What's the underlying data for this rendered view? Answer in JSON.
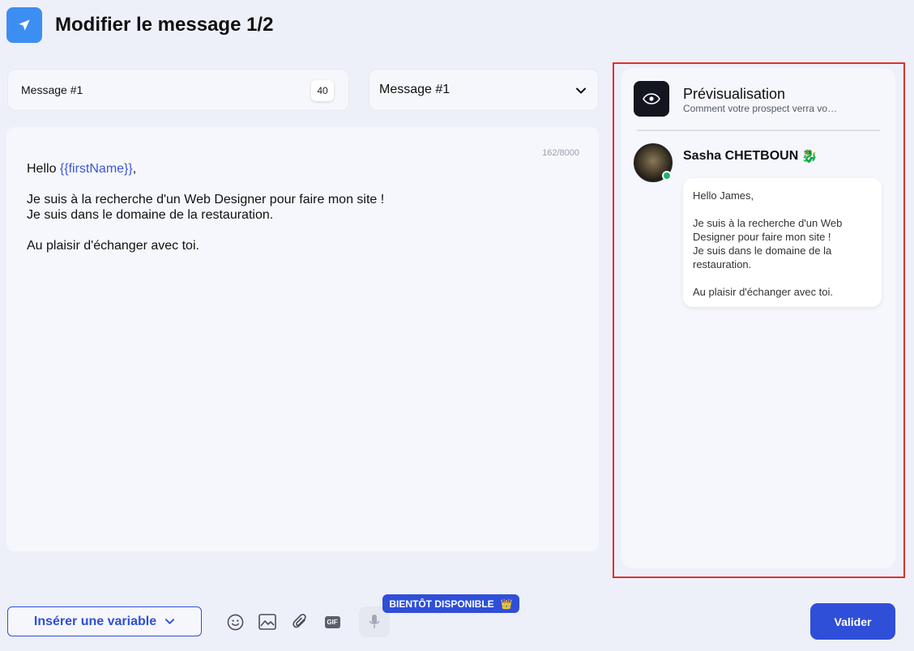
{
  "header": {
    "title": "Modifier le message 1/2",
    "icon": "paper-plane-icon"
  },
  "name_field": {
    "value": "Message #1",
    "count": "40"
  },
  "message_select": {
    "selected": "Message #1"
  },
  "editor": {
    "char_counter": "162/8000",
    "lines": {
      "hello": "Hello ",
      "variable": "{{firstName}}",
      "after_var": ",",
      "line2": "Je suis à la recherche d'un Web Designer pour faire mon site !",
      "line3": "Je suis dans le domaine de la restauration.",
      "line4": "Au plaisir d'échanger avec toi."
    }
  },
  "preview": {
    "title": "Prévisualisation",
    "subtitle": "Comment votre prospect verra vo…",
    "sender_name": "Sasha CHETBOUN",
    "sender_emoji": "🐉",
    "bubble": {
      "l1": "Hello James,",
      "l2": "Je suis à la recherche d'un Web",
      "l3": "Designer pour faire mon site !",
      "l4": "Je suis dans le domaine de la",
      "l5": "restauration.",
      "l6": "Au plaisir d'échanger avec toi."
    }
  },
  "toolbar": {
    "insert_variable": "Insérer une variable",
    "gif_label": "GIF",
    "soon_badge": "BIENTÔT DISPONIBLE",
    "soon_icon": "👑",
    "validate": "Valider"
  },
  "colors": {
    "accent": "#2f4fd8",
    "highlight_border": "#e0312a",
    "online": "#19b46b"
  }
}
